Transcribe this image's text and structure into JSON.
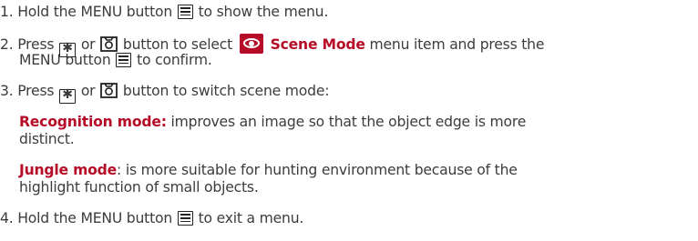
{
  "steps": {
    "s1": {
      "num": "1.",
      "a": "Hold the MENU button",
      "b": "to show the menu."
    },
    "s2": {
      "num": "2.",
      "a": "Press",
      "or": "or",
      "b": "button to select",
      "highlight": "Scene Mode",
      "c": "menu item and press the",
      "d": "MENU button",
      "e": "to confirm."
    },
    "s3": {
      "num": "3.",
      "a": "Press",
      "or": "or",
      "b": "button to switch scene mode:"
    },
    "recognition": {
      "label": "Recognition mode:",
      "text1": "improves an image so that the object edge is more",
      "text2": "distinct."
    },
    "jungle": {
      "label": "Jungle mode",
      "text1": ": is more suitable for hunting environment because of the",
      "text2": "highlight function of small objects."
    },
    "s4": {
      "num": "4.",
      "a": "Hold the MENU button",
      "b": "to exit a menu."
    }
  },
  "icons": [
    "menu-button-icon",
    "sun-button-icon",
    "camera-button-icon",
    "eye-icon"
  ],
  "colors": {
    "text": "#3c3c3c",
    "accent": "#b70c27",
    "icon": "#222222"
  }
}
